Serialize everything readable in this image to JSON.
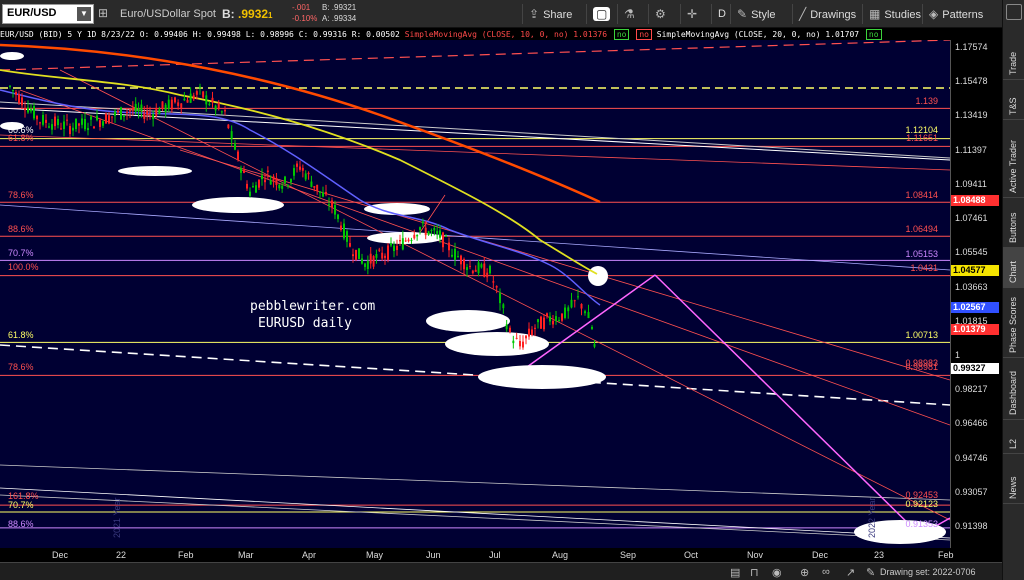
{
  "toolbar": {
    "symbol": "EUR/USD",
    "description": "Euro/USDollar Spot",
    "bid_label": "B:",
    "bid_value": ".9932",
    "bid_suffix": "1",
    "change": "-.001",
    "change_pct": "-0.10%",
    "bid_small": "B: .99321",
    "ask_small": "A: .99334",
    "share_label": "Share",
    "period_label": "D",
    "style_label": "Style",
    "drawings_label": "Drawings",
    "studies_label": "Studies",
    "patterns_label": "Patterns"
  },
  "study_header": {
    "symbol_info": "EUR/USD (BID) 5 Y 1D",
    "date": "8/23/22",
    "open": "O: 0.99406",
    "high": "H: 0.99498",
    "low": "L: 0.98996",
    "close": "C: 0.99316",
    "range": "R: 0.00502",
    "sma10": "SimpleMovingAvg (CLOSE, 10, 0, no)",
    "sma10_value": "1.01376",
    "sma20": "SimpleMovingAvg (CLOSE, 20, 0, no)",
    "sma20_value": "1.01707",
    "no1": "no",
    "no2": "no",
    "no3": "no"
  },
  "chart": {
    "watermark_line1": "pebblewriter.com",
    "watermark_line2": "EURUSD daily",
    "year_label_2021": "2021 Year",
    "year_label_2022": "2022 Year"
  },
  "left_labels": [
    {
      "text": "60.6%",
      "color": "#ffffff"
    },
    {
      "text": "61.8%",
      "color": "#ff5050"
    },
    {
      "text": "78.6%",
      "color": "#ff5050"
    },
    {
      "text": "88.6%",
      "color": "#ff5050"
    },
    {
      "text": "70.7%",
      "color": "#cc88ff"
    },
    {
      "text": "100.0%",
      "color": "#ff5050"
    },
    {
      "text": "61.8%",
      "color": "#ffff66"
    },
    {
      "text": "78.6%",
      "color": "#ff5050"
    },
    {
      "text": "161.8%",
      "color": "#ff5050"
    },
    {
      "text": "70.7%",
      "color": "#ffff66"
    },
    {
      "text": "88.6%",
      "color": "#cc88ff"
    }
  ],
  "right_labels": [
    {
      "text": "1.139",
      "color": "#ff5050"
    },
    {
      "text": "1.12104",
      "color": "#ffff66"
    },
    {
      "text": "1.11651",
      "color": "#ff5050"
    },
    {
      "text": "1.08414",
      "color": "#ff5050"
    },
    {
      "text": "1.06494",
      "color": "#ff5050"
    },
    {
      "text": "1.05153",
      "color": "#cc88ff"
    },
    {
      "text": "1.0431",
      "color": "#ff5050"
    },
    {
      "text": "1.00713",
      "color": "#ffff66"
    },
    {
      "text": "0.98983",
      "color": "#ff5050"
    },
    {
      "text": "0.98981",
      "color": "#ff5050"
    },
    {
      "text": "0.92453",
      "color": "#ff5050"
    },
    {
      "text": "0.92123",
      "color": "#ffff66"
    },
    {
      "text": "0.91353",
      "color": "#cc88ff"
    }
  ],
  "price_axis": {
    "ticks": [
      "1.17574",
      "1.15478",
      "1.13419",
      "1.11397",
      "1.09411",
      "1.07461",
      "1.05545",
      "1.03663",
      "1.01815",
      "1",
      "0.98217",
      "0.96466",
      "0.94746",
      "0.93057",
      "0.91398"
    ],
    "badges": [
      {
        "text": "1.08488",
        "bg": "#ff3030",
        "fg": "#ffffff"
      },
      {
        "text": "1.04577",
        "bg": "#f5e400",
        "fg": "#000000"
      },
      {
        "text": "1.02567",
        "bg": "#3050ff",
        "fg": "#ffffff"
      },
      {
        "text": "1.01379",
        "bg": "#ff3030",
        "fg": "#ffffff"
      },
      {
        "text": "0.99327",
        "bg": "#ffffff",
        "fg": "#000000"
      }
    ]
  },
  "date_axis": {
    "ticks": [
      "Dec",
      "22",
      "Feb",
      "Mar",
      "Apr",
      "May",
      "Jun",
      "Jul",
      "Aug",
      "Sep",
      "Oct",
      "Nov",
      "Dec",
      "23",
      "Feb"
    ]
  },
  "sidebar": {
    "tabs": [
      "Trade",
      "T&S",
      "Active Trader",
      "Buttons",
      "Chart",
      "Phase Scores",
      "Dashboard",
      "L2",
      "News"
    ]
  },
  "bottombar": {
    "drawing_set": "Drawing set: 2022-0706"
  },
  "chart_data": {
    "type": "candlestick",
    "symbol": "EUR/USD (BID) 5 Y 1D",
    "y_scale": "log",
    "ylim": [
      0.905,
      1.185
    ],
    "x_period": "daily, Nov 2021 – Aug 2022, axis extends to Feb 2023",
    "last_close": 0.99327,
    "sma10_last": 1.01376,
    "sma20_last": 1.01707,
    "approx_closes": [
      {
        "date": "Dec 2021",
        "close": 1.13
      },
      {
        "date": "Jan 2022",
        "close": 1.135
      },
      {
        "date": "Feb 2022",
        "close": 1.135
      },
      {
        "date": "Mar 2022",
        "close": 1.1
      },
      {
        "date": "Apr 2022",
        "close": 1.08
      },
      {
        "date": "May 2022",
        "close": 1.055
      },
      {
        "date": "Jun 2022",
        "close": 1.045
      },
      {
        "date": "Jul 2022",
        "close": 1.015
      },
      {
        "date": "Aug 2022",
        "close": 1.02
      },
      {
        "date": "8/23/22",
        "close": 0.99316
      }
    ]
  }
}
